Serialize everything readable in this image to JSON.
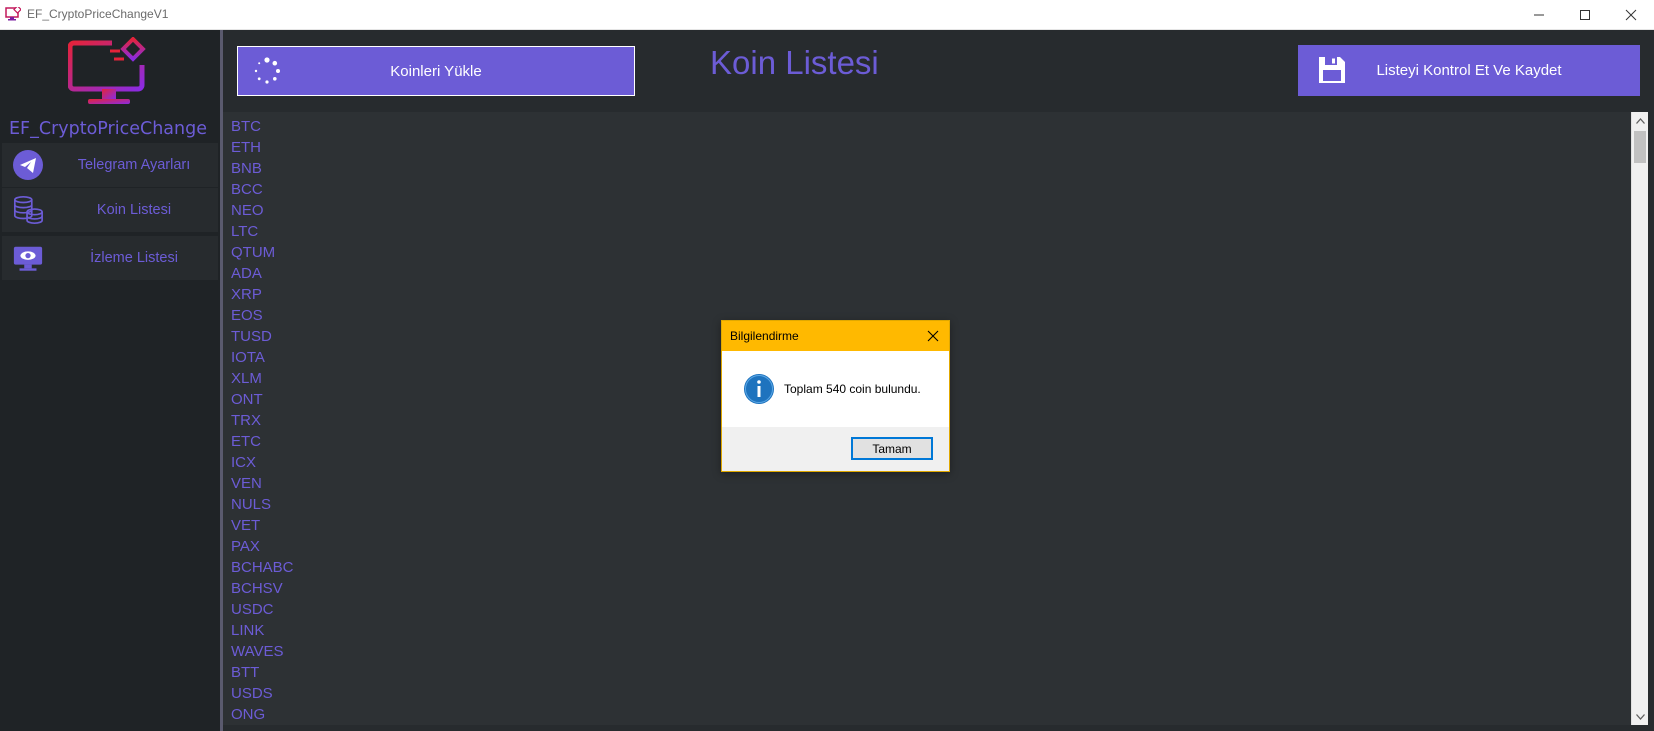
{
  "window": {
    "title": "EF_CryptoPriceChangeV1",
    "icon": "monitor-icon"
  },
  "colors": {
    "accent": "#6c5cd6",
    "sidebar_bg": "#1f2326",
    "main_bg": "#272b2e",
    "list_bg": "#2d3134",
    "dialog_title_bg": "#ffb900",
    "logo_gradient_start": "#e4233a",
    "logo_gradient_end": "#8a2be2"
  },
  "sidebar": {
    "brand": "EF_CryptoPriceChange",
    "logo_icon": "crypto-monitor-logo-icon",
    "items": [
      {
        "label": "Telegram Ayarları",
        "icon": "telegram-icon"
      },
      {
        "label": "Koin Listesi",
        "icon": "coin-stack-icon"
      },
      {
        "label": "İzleme Listesi",
        "icon": "monitor-eye-icon"
      }
    ]
  },
  "header": {
    "load_button": "Koinleri Yükle",
    "load_icon": "loading-spinner-icon",
    "title": "Koin Listesi",
    "save_button": "Listeyi Kontrol Et Ve Kaydet",
    "save_icon": "floppy-disk-icon"
  },
  "coins": [
    "BTC",
    "ETH",
    "BNB",
    "BCC",
    "NEO",
    "LTC",
    "QTUM",
    "ADA",
    "XRP",
    "EOS",
    "TUSD",
    "IOTA",
    "XLM",
    "ONT",
    "TRX",
    "ETC",
    "ICX",
    "VEN",
    "NULS",
    "VET",
    "PAX",
    "BCHABC",
    "BCHSV",
    "USDC",
    "LINK",
    "WAVES",
    "BTT",
    "USDS",
    "ONG"
  ],
  "dialog": {
    "title": "Bilgilendirme",
    "message": "Toplam 540 coin bulundu.",
    "ok_button": "Tamam",
    "info_icon": "info-icon"
  }
}
